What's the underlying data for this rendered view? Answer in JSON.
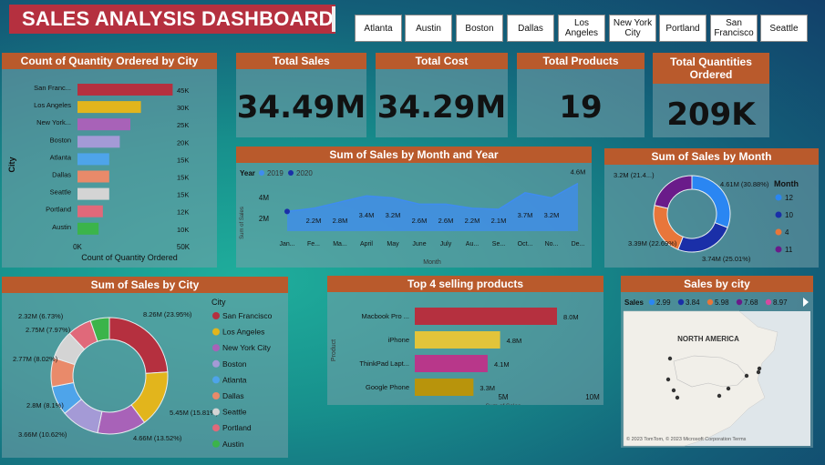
{
  "dashboard": {
    "title": "SALES ANALYSIS DASHBOARD"
  },
  "city_filters": [
    "Atlanta",
    "Austin",
    "Boston",
    "Dallas",
    "Los Angeles",
    "New York City",
    "Portland",
    "San Francisco",
    "Seattle"
  ],
  "kpis": {
    "total_sales": {
      "label": "Total Sales",
      "value": "34.49M"
    },
    "total_cost": {
      "label": "Total Cost",
      "value": "34.29M"
    },
    "total_products": {
      "label": "Total Products",
      "value": "19"
    },
    "total_quantities": {
      "label": "Total Quantities Ordered",
      "value": "209K"
    }
  },
  "chart_data": [
    {
      "id": "qty_by_city",
      "type": "bar",
      "orientation": "horizontal",
      "title": "Count of Quantity Ordered by City",
      "ylabel": "City",
      "xlabel": "Count of Quantity Ordered",
      "categories": [
        "San Franc...",
        "Los Angeles",
        "New York...",
        "Boston",
        "Atlanta",
        "Dallas",
        "Seattle",
        "Portland",
        "Austin"
      ],
      "values": [
        45000,
        30000,
        25000,
        20000,
        15000,
        15000,
        15000,
        12000,
        10000
      ],
      "data_labels": [
        "45K",
        "30K",
        "25K",
        "20K",
        "15K",
        "15K",
        "15K",
        "12K",
        "10K"
      ],
      "colors": [
        "#b5303f",
        "#e2b51c",
        "#a862b8",
        "#a49ad6",
        "#4ea4ea",
        "#e98a6a",
        "#d4d4d4",
        "#e0697a",
        "#3bb44a"
      ],
      "xlim": [
        0,
        50000
      ],
      "xticks": [
        "0K",
        "50K"
      ]
    },
    {
      "id": "sales_by_month_year",
      "type": "area",
      "title": "Sum of Sales by Month and Year",
      "xlabel": "Month",
      "ylabel": "Sum of Sales",
      "legend_title": "Year",
      "series": [
        {
          "name": "2019",
          "color": "#3f8cf0"
        },
        {
          "name": "2020",
          "color": "#1a2fa8"
        }
      ],
      "categories": [
        "Jan...",
        "Fe...",
        "Ma...",
        "April",
        "May",
        "June",
        "July",
        "Au...",
        "Se...",
        "Oct...",
        "No...",
        "De..."
      ],
      "values": [
        1.9,
        2.2,
        2.8,
        3.4,
        3.2,
        2.6,
        2.6,
        2.2,
        2.1,
        3.7,
        3.2,
        4.6
      ],
      "data_labels": [
        "",
        "2.2M",
        "2.8M",
        "3.4M",
        "3.2M",
        "2.6M",
        "2.6M",
        "2.2M",
        "2.1M",
        "3.7M",
        "3.2M",
        "4.6M"
      ],
      "yticks": [
        "2M",
        "4M"
      ],
      "ylim": [
        0,
        5
      ]
    },
    {
      "id": "sales_by_month",
      "type": "pie",
      "donut": true,
      "title": "Sum of Sales by Month",
      "legend_title": "Month",
      "categories": [
        "12",
        "10",
        "4",
        "11"
      ],
      "values": [
        4.61,
        3.74,
        3.39,
        3.2
      ],
      "labels": [
        "4.61M (30.88%)",
        "3.74M (25.01%)",
        "3.39M (22.69%)",
        "3.2M (21.4...)"
      ],
      "colors": [
        "#2a86f2",
        "#1a2fa8",
        "#e8763a",
        "#6a1b8a"
      ]
    },
    {
      "id": "sales_by_city",
      "type": "pie",
      "donut": true,
      "title": "Sum of Sales by City",
      "legend_title": "City",
      "categories": [
        "San Francisco",
        "Los Angeles",
        "New York City",
        "Boston",
        "Atlanta",
        "Dallas",
        "Seattle",
        "Portland",
        "Austin"
      ],
      "values": [
        8.26,
        5.45,
        4.66,
        3.66,
        2.8,
        2.77,
        2.75,
        2.32,
        1.82
      ],
      "labels": [
        "8.26M (23.95%)",
        "5.45M (15.81%)",
        "4.66M (13.52%)",
        "3.66M (10.62%)",
        "2.8M (8.1%)",
        "2.77M (8.02%)",
        "2.75M (7.97%)",
        "2.32M (6.73%)",
        ""
      ],
      "colors": [
        "#b5303f",
        "#e2b51c",
        "#a862b8",
        "#a49ad6",
        "#4ea4ea",
        "#e98a6a",
        "#d4d4d4",
        "#e0697a",
        "#3bb44a"
      ]
    },
    {
      "id": "top_products",
      "type": "bar",
      "orientation": "horizontal",
      "title": "Top 4 selling products",
      "ylabel": "Product",
      "xlabel": "Sum of Sales",
      "categories": [
        "Macbook Pro ...",
        "iPhone",
        "ThinkPad Lapt...",
        "Google Phone"
      ],
      "values": [
        8.0,
        4.8,
        4.1,
        3.3
      ],
      "data_labels": [
        "8.0M",
        "4.8M",
        "4.1M",
        "3.3M"
      ],
      "colors": [
        "#b5303f",
        "#e2c43a",
        "#b8378a",
        "#b8940c"
      ],
      "xlim": [
        0,
        10
      ],
      "xticks": [
        "0M",
        "5M",
        "10M"
      ]
    },
    {
      "id": "sales_by_city_map",
      "type": "scatter",
      "title": "Sales by city",
      "legend_title": "Sales",
      "legend": [
        "2.99",
        "3.84",
        "5.98",
        "7.68",
        "8.97"
      ],
      "legend_colors": [
        "#2a86f2",
        "#1a2fa8",
        "#e8763a",
        "#6a1b8a",
        "#d44aa0"
      ],
      "map_label": "NORTH AMERICA",
      "attribution": "© 2023 TomTom, © 2023 Microsoft Corporation  Terms"
    }
  ]
}
